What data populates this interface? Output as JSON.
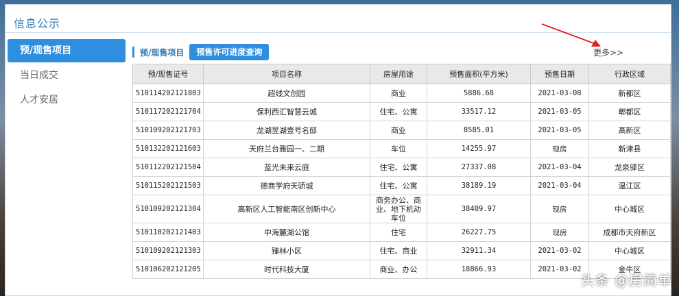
{
  "panel": {
    "title": "信息公示"
  },
  "sidebar": {
    "items": [
      {
        "label": "预/现售项目",
        "active": true
      },
      {
        "label": "当日成交",
        "active": false
      },
      {
        "label": "人才安居",
        "active": false
      }
    ]
  },
  "tabs": {
    "tab1": "预/现售项目",
    "tab2": "预售许可进度查询"
  },
  "more_link": "更多>>",
  "table": {
    "headers": [
      "预/现售证号",
      "项目名称",
      "房屋用途",
      "预售面积(平方米)",
      "预售日期",
      "行政区域"
    ],
    "rows": [
      [
        "510114202121803",
        "超线文创园",
        "商业",
        "5886.68",
        "2021-03-08",
        "新都区"
      ],
      [
        "510117202121704",
        "保利西汇智慧云城",
        "住宅、公寓",
        "33517.12",
        "2021-03-05",
        "郫都区"
      ],
      [
        "510109202121703",
        "龙湖昱湖壹号名邸",
        "商业",
        "8585.01",
        "2021-03-05",
        "高新区"
      ],
      [
        "510132202121603",
        "天府兰台雅园一、二期",
        "车位",
        "14255.97",
        "现房",
        "新津县"
      ],
      [
        "510112202121504",
        "蓝光未来云庭",
        "住宅、公寓",
        "27337.08",
        "2021-03-04",
        "龙泉驿区"
      ],
      [
        "510115202121503",
        "德商学府天骄城",
        "住宅、公寓",
        "38189.19",
        "2021-03-04",
        "温江区"
      ],
      [
        "510109202121304",
        "高新区人工智能南区创新中心",
        "商务办公、商业、地下机动车位",
        "38409.97",
        "现房",
        "中心城区"
      ],
      [
        "510110202121403",
        "中海麓湖公馆",
        "住宅",
        "26227.75",
        "现房",
        "成都市天府新区"
      ],
      [
        "510109202121303",
        "臻林小区",
        "住宅、商业",
        "32911.34",
        "2021-03-02",
        "中心城区"
      ],
      [
        "510106202121205",
        "时代科技大厦",
        "商业、办公",
        "18866.93",
        "2021-03-02",
        "金牛区"
      ]
    ]
  },
  "watermark": "头条 @房简单",
  "colors": {
    "accent": "#2e8ee0",
    "title": "#2e78b7",
    "arrow": "#e02020"
  }
}
